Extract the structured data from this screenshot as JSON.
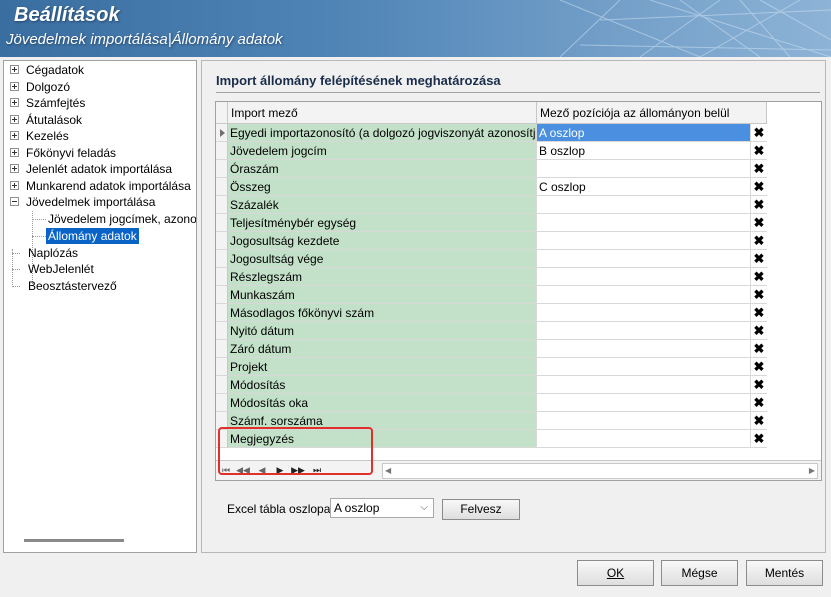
{
  "header": {
    "title": "Beállítások",
    "subtitle": "Jövedelmek importálása|Állomány adatok"
  },
  "tree": {
    "items": [
      {
        "label": "Cégadatok",
        "expander": "plus"
      },
      {
        "label": "Dolgozó",
        "expander": "plus"
      },
      {
        "label": "Számfejtés",
        "expander": "plus"
      },
      {
        "label": "Átutalások",
        "expander": "plus"
      },
      {
        "label": "Kezelés",
        "expander": "plus"
      },
      {
        "label": "Főkönyvi feladás",
        "expander": "plus"
      },
      {
        "label": "Jelenlét adatok importálása",
        "expander": "plus"
      },
      {
        "label": "Munkarend adatok importálása",
        "expander": "plus"
      },
      {
        "label": "Jövedelmek importálása",
        "expander": "minus"
      },
      {
        "label": "Jövedelem jogcímek, azonos",
        "child": true
      },
      {
        "label": "Állomány adatok",
        "child": true,
        "selected": true
      },
      {
        "label": "Naplózás"
      },
      {
        "label": "WebJelenlét"
      },
      {
        "label": "Beosztástervező"
      }
    ]
  },
  "main": {
    "section_title": "Import állomány felépítésének meghatározása",
    "grid": {
      "columns": [
        "Import mező",
        "Mező pozíciója az állományon belül"
      ],
      "rows": [
        {
          "field": "Egyedi importazonosító (a dolgozó jogviszonyát azonosítja)",
          "position": "A oszlop"
        },
        {
          "field": "Jövedelem jogcím",
          "position": "B oszlop"
        },
        {
          "field": "Óraszám",
          "position": ""
        },
        {
          "field": "Összeg",
          "position": "C oszlop"
        },
        {
          "field": "Százalék",
          "position": ""
        },
        {
          "field": "Teljesítménybér egység",
          "position": ""
        },
        {
          "field": "Jogosultság kezdete",
          "position": ""
        },
        {
          "field": "Jogosultság vége",
          "position": ""
        },
        {
          "field": "Részlegszám",
          "position": ""
        },
        {
          "field": "Munkaszám",
          "position": ""
        },
        {
          "field": "Másodlagos főkönyvi szám",
          "position": ""
        },
        {
          "field": "Nyitó dátum",
          "position": ""
        },
        {
          "field": "Záró dátum",
          "position": ""
        },
        {
          "field": "Projekt",
          "position": ""
        },
        {
          "field": "Módosítás",
          "position": ""
        },
        {
          "field": "Módosítás oka",
          "position": ""
        },
        {
          "field": "Számf. sorszáma",
          "position": ""
        },
        {
          "field": "Megjegyzés",
          "position": ""
        }
      ],
      "delete_glyph": "✖",
      "nav": [
        "⏮",
        "◀◀",
        "◀",
        "▶",
        "▶▶",
        "⏭"
      ]
    },
    "excel_label": "Excel tábla oszlopa",
    "excel_value": "A oszlop",
    "felvesz_label": "Felvesz"
  },
  "footer": {
    "ok_label": "OK",
    "megse_label": "Mégse",
    "mentes_label": "Mentés"
  },
  "colors": {
    "field_bg": "#c3e0c8",
    "selection": "#0a64c8",
    "highlight_box": "#e0302a"
  }
}
